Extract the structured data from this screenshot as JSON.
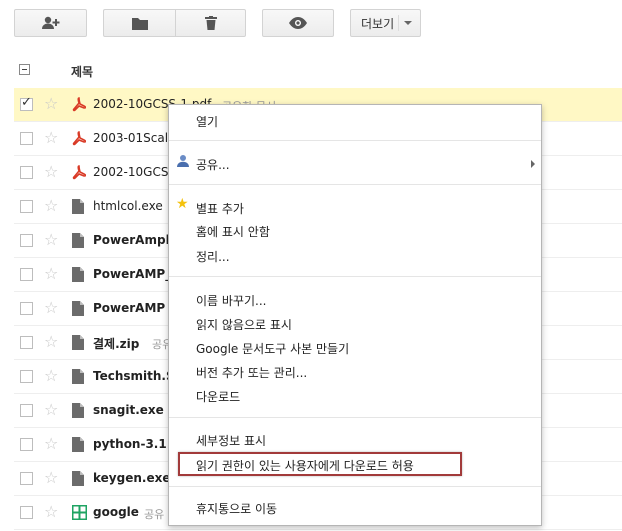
{
  "toolbar": {
    "add_user_icon": "person-add-icon",
    "folder_icon": "folder-icon",
    "trash_icon": "trash-icon",
    "eye_icon": "eye-icon",
    "more_label": "더보기"
  },
  "header": {
    "title": "제목"
  },
  "files": [
    {
      "name": "2002-10GCSS-1.pdf",
      "shared": "공유한 문서",
      "icon": "pdf-icon",
      "checked": true
    },
    {
      "name": "2003-01Scal",
      "shared": "",
      "icon": "pdf-icon",
      "checked": false
    },
    {
      "name": "2002-10GCS",
      "shared": "",
      "icon": "pdf-icon",
      "checked": false
    },
    {
      "name": "htmlcol.exe",
      "shared": "",
      "icon": "file-icon",
      "checked": false
    },
    {
      "name": "PowerAmpl",
      "shared": "",
      "icon": "file-icon",
      "checked": false
    },
    {
      "name": "PowerAMP_",
      "shared": "",
      "icon": "file-icon",
      "checked": false
    },
    {
      "name": "PowerAMP",
      "shared": "",
      "icon": "file-icon",
      "checked": false
    },
    {
      "name": "결제.zip",
      "shared": "공유",
      "icon": "file-icon",
      "checked": false
    },
    {
      "name": "Techsmith.S",
      "shared": "",
      "icon": "file-icon",
      "checked": false
    },
    {
      "name": "snagit.exe",
      "shared": "",
      "icon": "file-icon",
      "checked": false
    },
    {
      "name": "python-3.1.3",
      "shared": "",
      "icon": "file-icon",
      "checked": false
    },
    {
      "name": "keygen.exe",
      "shared": "",
      "icon": "file-icon",
      "checked": false
    },
    {
      "name": "google",
      "shared": "공유",
      "icon": "spreadsheet-icon",
      "checked": false
    }
  ],
  "context_menu": {
    "open": "열기",
    "share": "공유...",
    "star": "별표 추가",
    "hide_home": "홈에 표시 안함",
    "organize": "정리...",
    "rename": "이름 바꾸기...",
    "mark_unread": "읽지 않음으로 표시",
    "make_copy": "Google 문서도구 사본 만들기",
    "versions": "버전 추가 또는 관리...",
    "download": "다운로드",
    "details": "세부정보 표시",
    "allow_download": "읽기 권한이 있는 사용자에게 다운로드 허용",
    "trash": "휴지통으로 이동"
  },
  "colors": {
    "selected_row": "#fff8c5",
    "highlight_border": "#a23a3a",
    "pdf_red": "#d93a26",
    "sheet_green": "#1fa463",
    "star_yellow": "#f4c20d"
  }
}
